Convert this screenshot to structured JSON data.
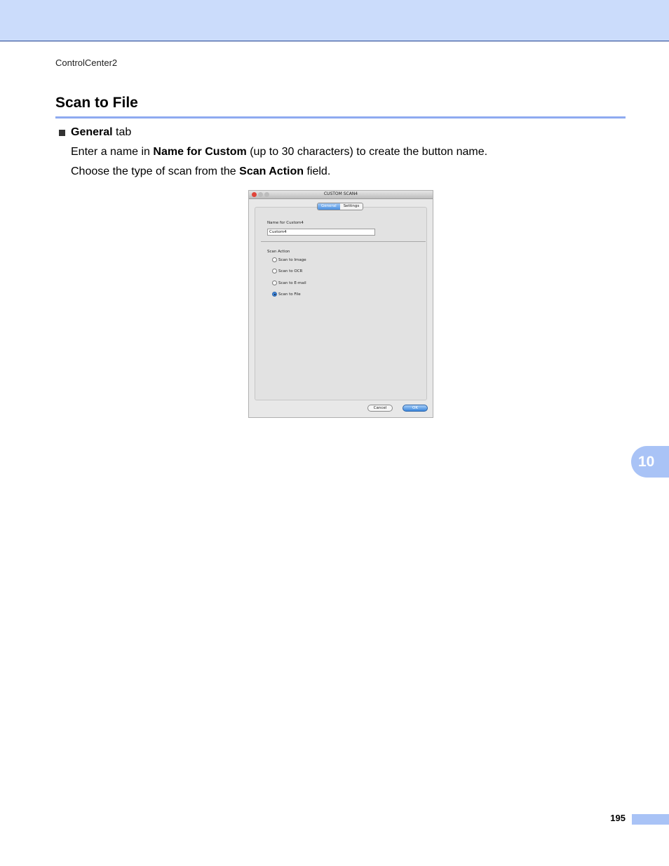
{
  "header": {
    "running_title": "ControlCenter2"
  },
  "section": {
    "title": "Scan to File"
  },
  "bullet": {
    "bold": "General",
    "rest": " tab"
  },
  "para1": {
    "t1": "Enter a name in ",
    "b1": "Name for Custom",
    "t2": " (up to 30 characters) to create the button name."
  },
  "para2": {
    "t1": "Choose the type of scan from the ",
    "b1": "Scan Action",
    "t2": " field."
  },
  "dialog": {
    "title": "CUSTOM SCAN4",
    "tabs": [
      "General",
      "Settings"
    ],
    "active_tab": "General",
    "name_label": "Name for Custom4",
    "name_value": "Custom4",
    "scan_action_label": "Scan Action",
    "options": [
      "Scan to Image",
      "Scan to OCR",
      "Scan to E-mail",
      "Scan to File"
    ],
    "selected_option": "Scan to File",
    "cancel_label": "Cancel",
    "ok_label": "OK"
  },
  "chapter_tab": "10",
  "page_number": "195"
}
